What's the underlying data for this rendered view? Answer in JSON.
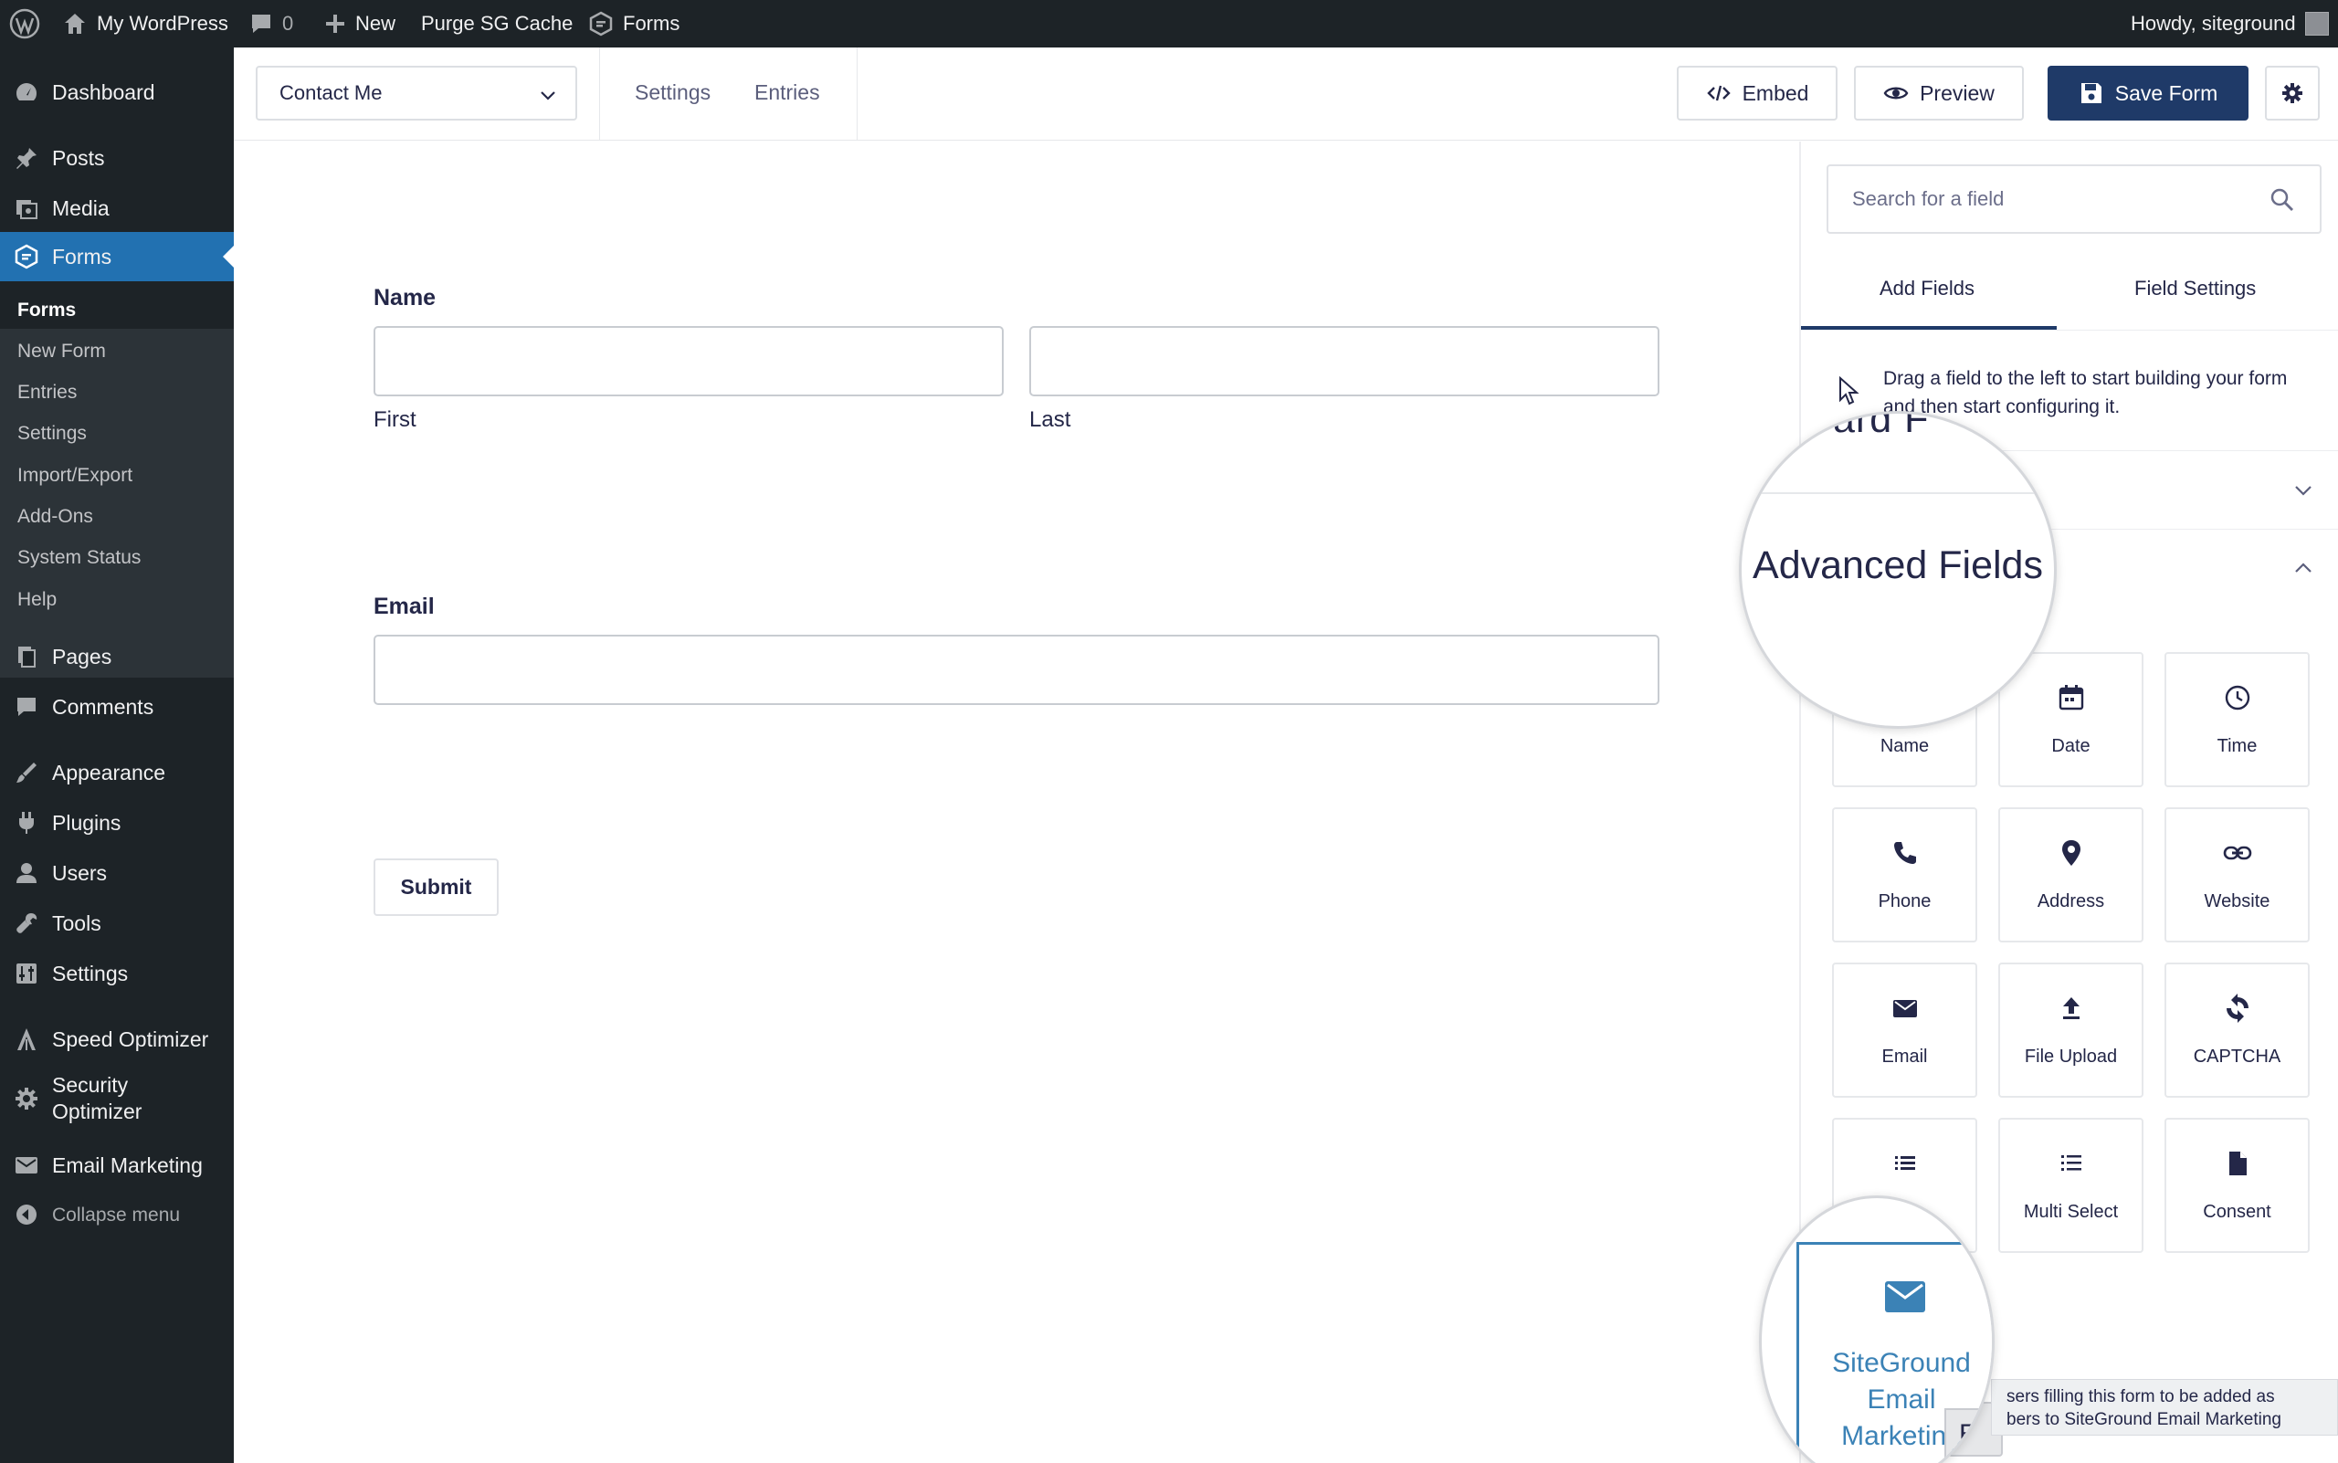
{
  "admin_bar": {
    "site_name": "My WordPress",
    "comments_count": "0",
    "new_label": "New",
    "purge_label": "Purge SG Cache",
    "forms_label": "Forms",
    "howdy": "Howdy, siteground"
  },
  "admin_menu": {
    "dashboard": "Dashboard",
    "posts": "Posts",
    "media": "Media",
    "forms": "Forms",
    "submenu": [
      "Forms",
      "New Form",
      "Entries",
      "Settings",
      "Import/Export",
      "Add-Ons",
      "System Status",
      "Help"
    ],
    "pages": "Pages",
    "comments": "Comments",
    "appearance": "Appearance",
    "plugins": "Plugins",
    "users": "Users",
    "tools": "Tools",
    "settings": "Settings",
    "speed_optimizer": "Speed Optimizer",
    "security_optimizer_1": "Security",
    "security_optimizer_2": "Optimizer",
    "email_marketing": "Email Marketing",
    "collapse": "Collapse menu"
  },
  "toolbar": {
    "form_select": "Contact Me",
    "tab_settings": "Settings",
    "tab_entries": "Entries",
    "embed": "Embed",
    "preview": "Preview",
    "save": "Save Form"
  },
  "canvas": {
    "name_label": "Name",
    "first": "First",
    "last": "Last",
    "email_label": "Email",
    "submit": "Submit"
  },
  "sidebar": {
    "search_placeholder": "Search for a field",
    "tab_add": "Add Fields",
    "tab_settings": "Field Settings",
    "hint": "Drag a field to the left to start building your form and then start configuring it.",
    "advanced_fields": "Advanced Fields",
    "partial_heading": "ard F",
    "tiles": [
      "Name",
      "Date",
      "Time",
      "Phone",
      "Address",
      "Website",
      "Email",
      "File Upload",
      "CAPTCHA",
      "Multi Select",
      "Consent"
    ],
    "sg_email_1": "SiteGround Email",
    "sg_email_2": "Marketing",
    "tooltip_1": "sers filling this form to be added as",
    "tooltip_2": "bers to SiteGround Email Marketing",
    "tooltip_partial": "En"
  },
  "colors": {
    "admin_dark": "#1d2327",
    "admin_active": "#2271b1",
    "primary": "#1f3a68",
    "sg_blue": "#3b82b6"
  }
}
